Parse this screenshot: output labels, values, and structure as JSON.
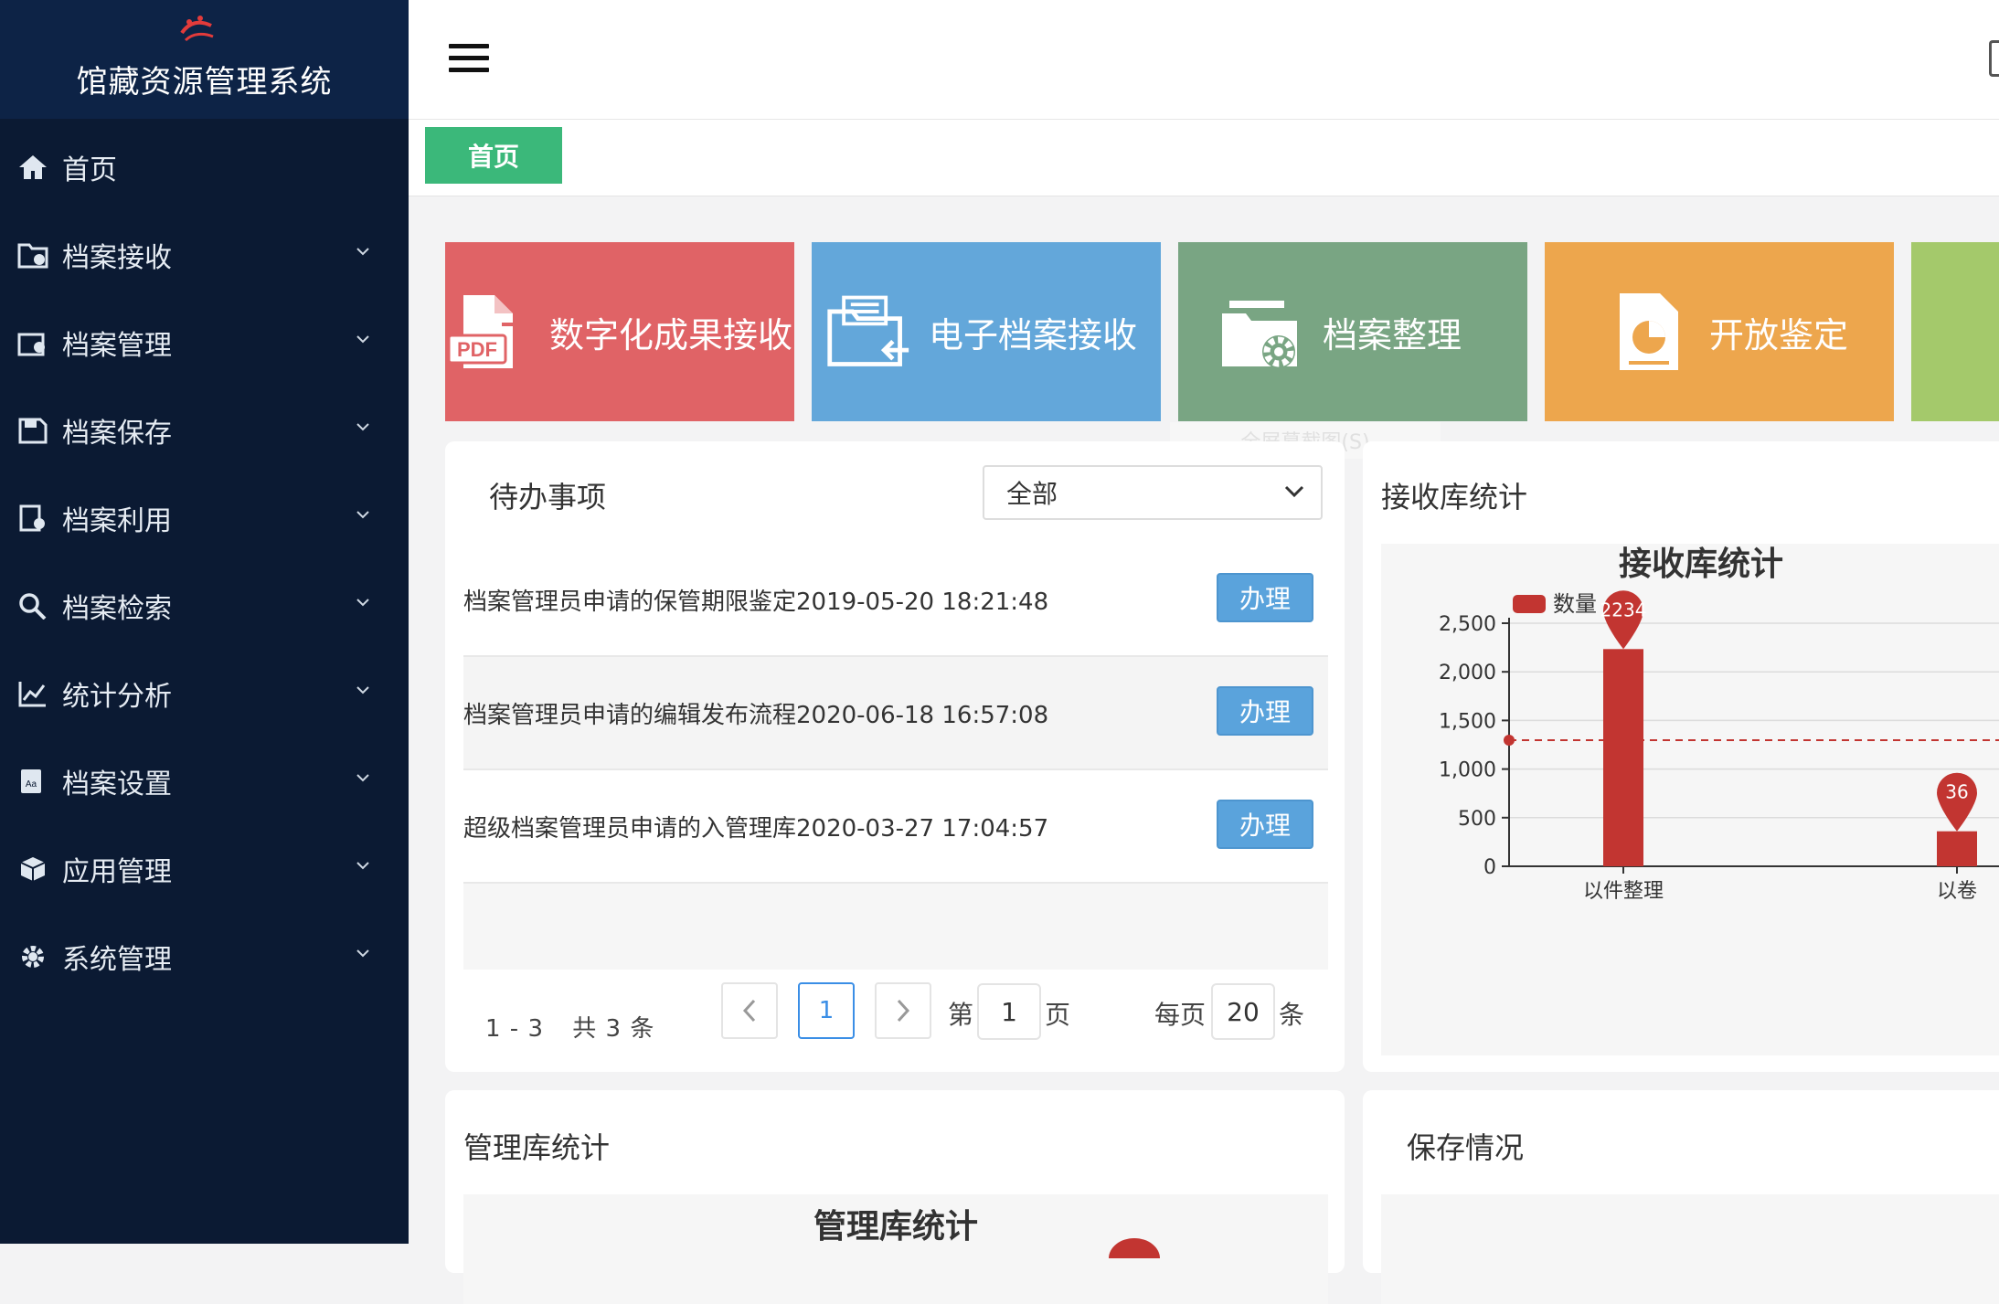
{
  "app": {
    "title": "馆藏资源管理系统"
  },
  "sidebar": {
    "items": [
      {
        "label": "首页",
        "icon": "home-icon"
      },
      {
        "label": "档案接收",
        "icon": "folder-receive-icon"
      },
      {
        "label": "档案管理",
        "icon": "archive-manage-icon"
      },
      {
        "label": "档案保存",
        "icon": "save-icon"
      },
      {
        "label": "档案利用",
        "icon": "document-use-icon"
      },
      {
        "label": "档案检索",
        "icon": "search-icon"
      },
      {
        "label": "统计分析",
        "icon": "line-chart-icon"
      },
      {
        "label": "档案设置",
        "icon": "settings-book-icon"
      },
      {
        "label": "应用管理",
        "icon": "cubes-icon"
      },
      {
        "label": "系统管理",
        "icon": "gear-icon"
      }
    ]
  },
  "tabs": {
    "home": "首页"
  },
  "tiles": [
    {
      "label": "数字化成果接收",
      "icon": "pdf-icon",
      "color": "#e06366"
    },
    {
      "label": "电子档案接收",
      "icon": "folder-in-icon",
      "color": "#63a7da"
    },
    {
      "label": "档案整理",
      "icon": "folder-gear-icon",
      "color": "#79a583"
    },
    {
      "label": "开放鉴定",
      "icon": "pie-document-icon",
      "color": "#eda64d"
    },
    {
      "label": "",
      "icon": "document-icon",
      "color": "#a4c96b"
    }
  ],
  "ghost_text": "全屏幕截图(S)",
  "todo": {
    "title": "待办事项",
    "filter_value": "全部",
    "action_label": "办理",
    "items": [
      {
        "text": "档案管理员申请的保管期限鉴定2019-05-20 18:21:48"
      },
      {
        "text": "档案管理员申请的编辑发布流程2020-06-18 16:57:08"
      },
      {
        "text": "超级档案管理员申请的入管理库2020-03-27 17:04:57"
      }
    ],
    "pager": {
      "range": "1 - 3",
      "total": "共 3 条",
      "current_page": "1",
      "page_prefix": "第",
      "page_suffix": "页",
      "page_input": "1",
      "per_page_prefix": "每页",
      "per_page_value": "20",
      "per_page_suffix": "条"
    }
  },
  "receive_stats": {
    "title": "接收库统计"
  },
  "management_stats": {
    "title": "管理库统计",
    "chart_title": "管理库统计"
  },
  "storage": {
    "title": "保存情况"
  },
  "chart_data": {
    "type": "bar",
    "title": "接收库统计",
    "legend": "数量",
    "legend_position": "top-left",
    "categories": [
      "以件整理",
      "以卷"
    ],
    "series": [
      {
        "name": "数量",
        "values": [
          2234,
          360
        ]
      }
    ],
    "max_label": "2234",
    "second_label": "36",
    "ylim": [
      0,
      2500
    ],
    "yticks": [
      "0",
      "500",
      "1,000",
      "1,500",
      "2,000",
      "2,500"
    ],
    "average_line": 1297,
    "bar_color": "#c23531",
    "grid": true
  }
}
